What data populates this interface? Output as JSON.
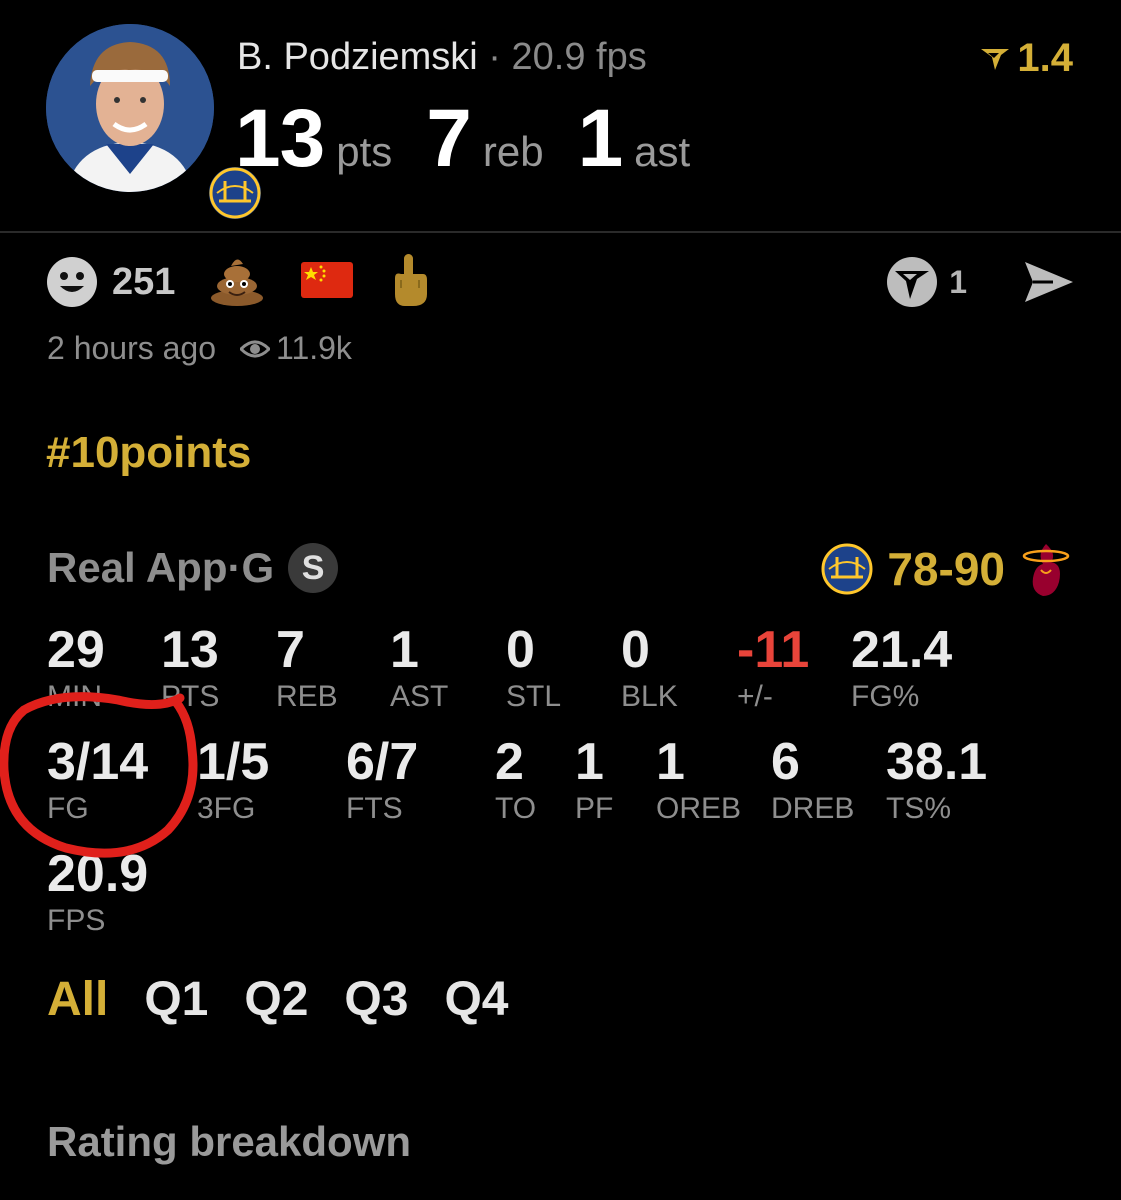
{
  "header": {
    "player_name": "B. Podziemski",
    "separator": " · ",
    "fps_label": "20.9 fps",
    "pts": "13",
    "pts_unit": "pts",
    "reb": "7",
    "reb_unit": "reb",
    "ast": "1",
    "ast_unit": "ast",
    "rating": "1.4",
    "accent": "#d4af37"
  },
  "reactions": {
    "smile_count": "251",
    "emojis": [
      "poop-emoji",
      "china-flag-emoji",
      "middle-finger-emoji"
    ],
    "comment_count": "1"
  },
  "meta": {
    "posted": "2 hours ago",
    "views": "11.9k"
  },
  "hashtag": "#10points",
  "game": {
    "source": "Real App",
    "position": "G",
    "sep": " · ",
    "badge": "S",
    "score": "78-90"
  },
  "stats_row1": [
    {
      "value": "29",
      "label": "MIN"
    },
    {
      "value": "13",
      "label": "PTS"
    },
    {
      "value": "7",
      "label": "REB"
    },
    {
      "value": "1",
      "label": "AST"
    },
    {
      "value": "0",
      "label": "STL"
    },
    {
      "value": "0",
      "label": "BLK"
    },
    {
      "value": "-11",
      "label": "+/-"
    },
    {
      "value": "21.4",
      "label": "FG%"
    }
  ],
  "stats_row2": [
    {
      "value": "3/14",
      "label": "FG"
    },
    {
      "value": "1/5",
      "label": "3FG"
    },
    {
      "value": "6/7",
      "label": "FTS"
    },
    {
      "value": "2",
      "label": "TO"
    },
    {
      "value": "1",
      "label": "PF"
    },
    {
      "value": "1",
      "label": "OREB"
    },
    {
      "value": "6",
      "label": "DREB"
    },
    {
      "value": "38.1",
      "label": "TS%"
    }
  ],
  "stats_row3": [
    {
      "value": "20.9",
      "label": "FPS"
    }
  ],
  "tabs": [
    "All",
    "Q1",
    "Q2",
    "Q3",
    "Q4"
  ],
  "active_tab": "All",
  "section_title": "Rating breakdown",
  "colors": {
    "negative": "#e8443a",
    "annotation": "#e0201b"
  }
}
